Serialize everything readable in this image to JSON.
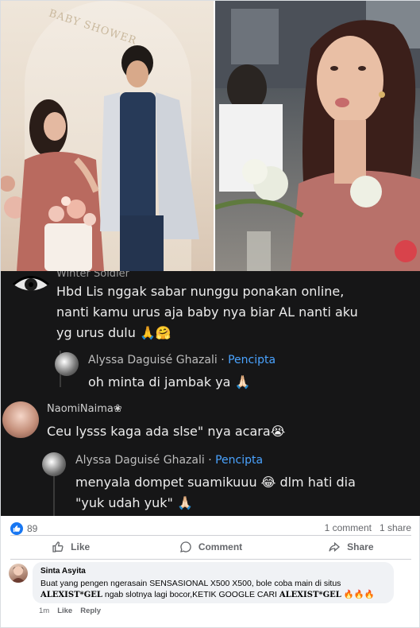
{
  "photo": {
    "left_sign": "BABY SHOWER"
  },
  "dark_comments": [
    {
      "author": "Winter Soldier",
      "text_lines": [
        "Hbd Lis nggak sabar nunggu ponakan online,",
        "nanti kamu urus aja baby nya biar AL nanti aku",
        "yg urus dulu 🙏🤗"
      ]
    },
    {
      "author": "Alyssa Daguisé Ghazali",
      "badge": "Pencipta",
      "text": "oh minta di jambak ya 🙏🏻"
    },
    {
      "author": "NaomiNaima❀",
      "text": "Ceu lysss kaga ada slse\" nya acara😭"
    },
    {
      "author": "Alyssa Daguisé Ghazali",
      "badge": "Pencipta",
      "text_lines": [
        "menyala dompet suamikuuu 😂 dlm hati dia",
        "\"yuk udah yuk\" 🙏🏻"
      ]
    }
  ],
  "post_stats": {
    "likes": "89",
    "comments": "1 comment",
    "shares": "1 share"
  },
  "actions": {
    "like": "Like",
    "comment": "Comment",
    "share": "Share"
  },
  "comment": {
    "author": "Sinta Asyita",
    "text_prefix": "Buat yang pengen ngerasain SENSASIONAL X500 X500, bole coba main di situs",
    "brand1": "ALEXIST*GEL",
    "text_mid": " ngab slotnya lagi bocor,KETIK GOOGLE CARI ",
    "brand2": "ALEXIST*GEL",
    "emoji": " 🔥🔥🔥",
    "time": "1m",
    "like": "Like",
    "reply": "Reply"
  },
  "colors": {
    "fb_blue": "#1877f2",
    "dark_bg": "#161617",
    "badge_blue": "#4aa3ff"
  }
}
